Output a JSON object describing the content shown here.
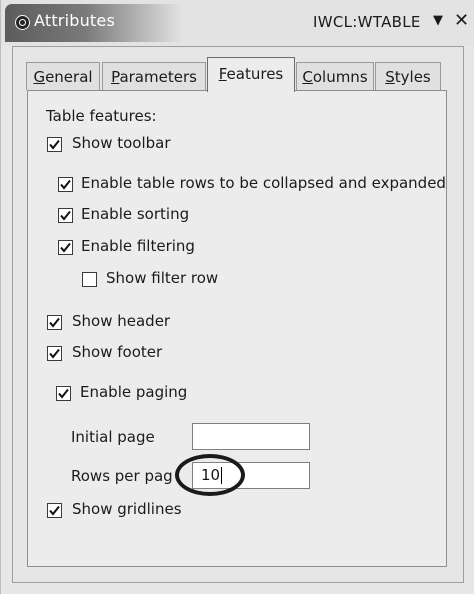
{
  "view": {
    "title": "Attributes",
    "context": "IWCL:WTABLE",
    "menu_glyph": "▼",
    "close_glyph": "✕"
  },
  "tabs": [
    {
      "label": "General",
      "mnemonic": "G",
      "rest": "eneral",
      "active": false
    },
    {
      "label": "Parameters",
      "mnemonic": "P",
      "rest": "arameters",
      "active": false
    },
    {
      "label": "Features",
      "mnemonic": "F",
      "rest": "eatures",
      "active": true
    },
    {
      "label": "Columns",
      "mnemonic": "C",
      "rest": "olumns",
      "active": false
    },
    {
      "label": "Styles",
      "mnemonic": "S",
      "rest": "tyles",
      "active": false
    }
  ],
  "features": {
    "heading": "Table features:",
    "show_toolbar": {
      "label": "Show toolbar",
      "checked": true
    },
    "collapse_rows": {
      "label": "Enable table rows to be collapsed and expanded",
      "checked": true
    },
    "sorting": {
      "label": "Enable sorting",
      "checked": true
    },
    "filtering": {
      "label": "Enable filtering",
      "checked": true
    },
    "filter_row": {
      "label": "Show filter row",
      "checked": false
    },
    "show_header": {
      "label": "Show header",
      "checked": true
    },
    "show_footer": {
      "label": "Show footer",
      "checked": true
    },
    "paging": {
      "label": "Enable paging",
      "checked": true
    },
    "initial_page": {
      "label": "Initial page",
      "value": ""
    },
    "rows_per_page": {
      "label": "Rows per pag",
      "value": "10"
    },
    "gridlines": {
      "label": "Show gridlines",
      "checked": true
    }
  }
}
